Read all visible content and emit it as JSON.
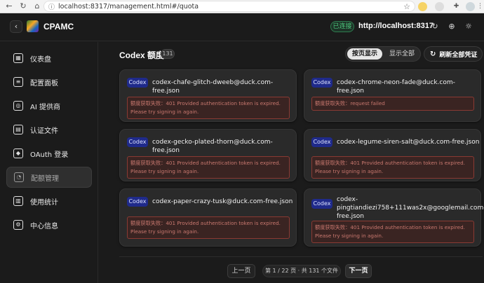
{
  "browser": {
    "url": "localhost:8317/management.html#/quota",
    "back_icon": "←",
    "refresh_icon": "↻",
    "home_icon": "⌂"
  },
  "header": {
    "title": "CPAMC",
    "connection_status": "已连接",
    "server_url": "http://localhost:8317"
  },
  "sidebar": {
    "items": [
      {
        "label": "仪表盘",
        "icon": "dashboard-icon",
        "glyph": "▦"
      },
      {
        "label": "配置面板",
        "icon": "sliders-icon",
        "glyph": "≡"
      },
      {
        "label": "AI 提供商",
        "icon": "bot-icon",
        "glyph": "◎"
      },
      {
        "label": "认证文件",
        "icon": "file-icon",
        "glyph": "▤"
      },
      {
        "label": "OAuth 登录",
        "icon": "shield-icon",
        "glyph": "◆"
      },
      {
        "label": "配额管理",
        "icon": "gauge-icon",
        "glyph": "◔"
      },
      {
        "label": "使用统计",
        "icon": "chart-icon",
        "glyph": "▥"
      },
      {
        "label": "中心信息",
        "icon": "info-icon",
        "glyph": "⚙"
      }
    ],
    "active_index": 5
  },
  "main": {
    "title": "Codex 额度",
    "count": "131",
    "view_toggle": {
      "paged": "按页显示",
      "all": "显示全部"
    },
    "refresh_all": "刷新全部凭证"
  },
  "cards": [
    {
      "tag": "Codex",
      "file": "codex-chafe-glitch-dweeb@duck.com-free.json",
      "error": "额度获取失败：401 Provided authentication token is expired. Please try signing in again."
    },
    {
      "tag": "Codex",
      "file": "codex-chrome-neon-fade@duck.com-free.json",
      "error": "额度获取失败：request failed"
    },
    {
      "tag": "Codex",
      "file": "codex-gecko-plated-thorn@duck.com-free.json",
      "error": "额度获取失败：401 Provided authentication token is expired. Please try signing in again."
    },
    {
      "tag": "Codex",
      "file": "codex-legume-siren-salt@duck.com-free.json",
      "error": "额度获取失败：401 Provided authentication token is expired. Please try signing in again."
    },
    {
      "tag": "Codex",
      "file": "codex-paper-crazy-tusk@duck.com-free.json",
      "error": "额度获取失败：401 Provided authentication token is expired. Please try signing in again."
    },
    {
      "tag": "Codex",
      "file": "codex-pingtiandiezi758+111was2x@googlemail.com-free.json",
      "error": "额度获取失败：401 Provided authentication token is expired. Please try signing in again."
    }
  ],
  "pagination": {
    "prev": "上一页",
    "info": "第 1 / 22 页 · 共 131 个文件",
    "next": "下一页"
  }
}
